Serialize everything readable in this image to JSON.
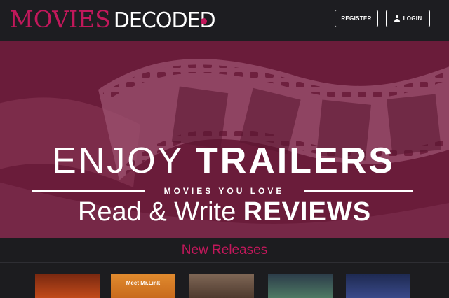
{
  "header": {
    "logo_part1": "MOVIES",
    "logo_part2": "DECODED",
    "register_label": "REGISTER",
    "login_label": "LOGIN"
  },
  "hero": {
    "line1_light": "ENJOY",
    "line1_bold": "TRAILERS",
    "tagline": "MOVIES YOU LOVE",
    "line3_light": "Read & Write",
    "line3_bold": "REVIEWS"
  },
  "new_releases": {
    "title": "New Releases",
    "posters": [
      {
        "caption": "",
        "color": "#8a2a12"
      },
      {
        "caption": "Meet Mr.Link",
        "color": "#e0802a"
      },
      {
        "caption": "",
        "color": "#6e5a4a"
      },
      {
        "caption": "",
        "color": "#3f6a5a"
      },
      {
        "caption": "",
        "color": "#2a3a6a"
      }
    ]
  },
  "colors": {
    "brand": "#c2185b",
    "header_bg": "#1d1d21",
    "hero_bg": "#6a1c3a"
  }
}
